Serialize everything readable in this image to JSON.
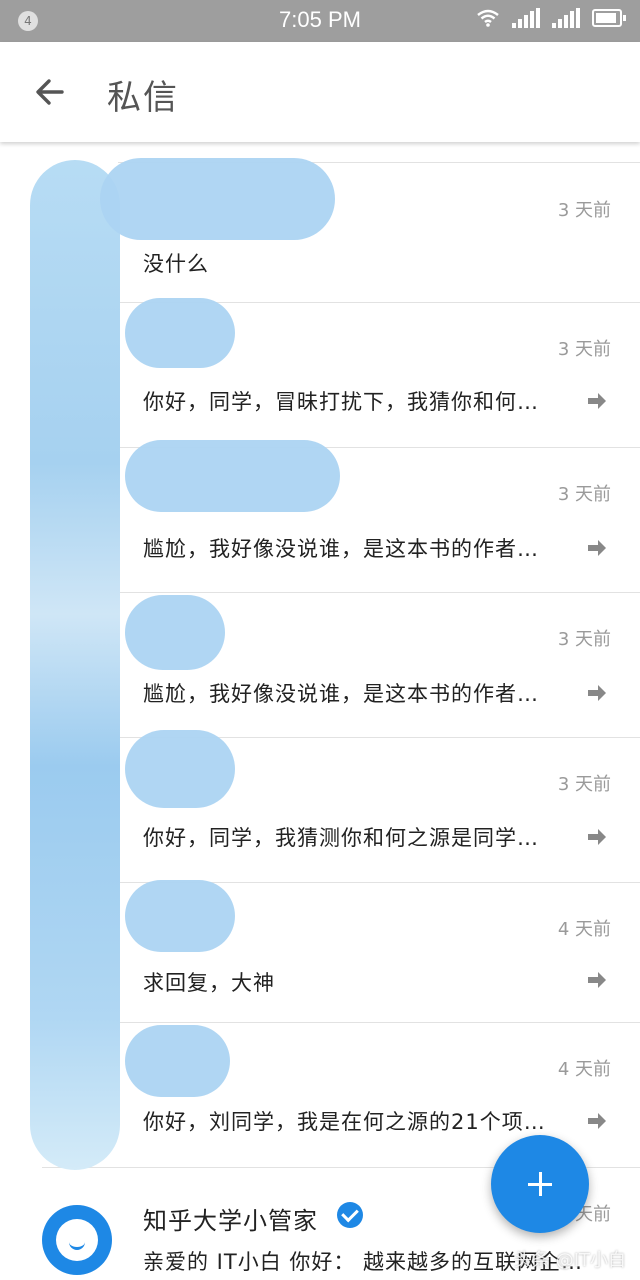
{
  "status_bar": {
    "notification_count": "4",
    "time": "7:05 PM"
  },
  "app_bar": {
    "title": "私信",
    "back_icon": "arrow-back-icon"
  },
  "conversations": [
    {
      "time": "3 天前",
      "message": "没什么",
      "has_reply_arrow": false
    },
    {
      "time": "3 天前",
      "message": "你好，同学，冒昧打扰下，我猜你和何…",
      "has_reply_arrow": true
    },
    {
      "time": "3 天前",
      "message": "尴尬，我好像没说谁，是这本书的作者…",
      "has_reply_arrow": true
    },
    {
      "time": "3 天前",
      "message": "尴尬，我好像没说谁，是这本书的作者…",
      "has_reply_arrow": true
    },
    {
      "time": "3 天前",
      "message": "你好，同学，我猜测你和何之源是同学…",
      "has_reply_arrow": true
    },
    {
      "time": "4 天前",
      "message": "求回复，大神",
      "has_reply_arrow": true
    },
    {
      "time": "4 天前",
      "message": "你好，刘同学，我是在何之源的21个项…",
      "has_reply_arrow": true
    },
    {
      "name": "知乎大学小管家",
      "verified": true,
      "time": "天前",
      "message": "亲爱的 IT小白 你好：  越来越多的互联网企…"
    }
  ],
  "fab": {
    "icon": "plus-icon"
  },
  "watermark": "头条 @IT小白",
  "colors": {
    "accent": "#1e88e5",
    "status_bar": "#9e9e9e"
  }
}
